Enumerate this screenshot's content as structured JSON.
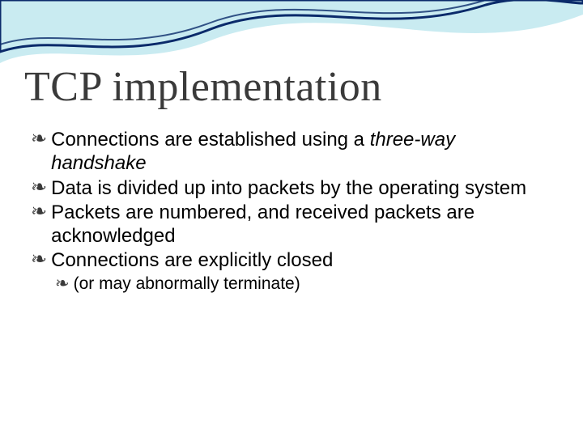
{
  "slide": {
    "title": "TCP implementation",
    "bullets": [
      {
        "pre": "Connections are established using a ",
        "italic": "three-way handshake",
        "post": ""
      },
      {
        "pre": "Data is divided up into packets by the operating system",
        "italic": "",
        "post": ""
      },
      {
        "pre": "Packets are numbered, and received packets are acknowledged",
        "italic": "",
        "post": ""
      },
      {
        "pre": "Connections are explicitly closed",
        "italic": "",
        "post": ""
      }
    ],
    "sub_bullet": {
      "pre": "(or may abnormally terminate)",
      "italic": "",
      "post": ""
    }
  }
}
